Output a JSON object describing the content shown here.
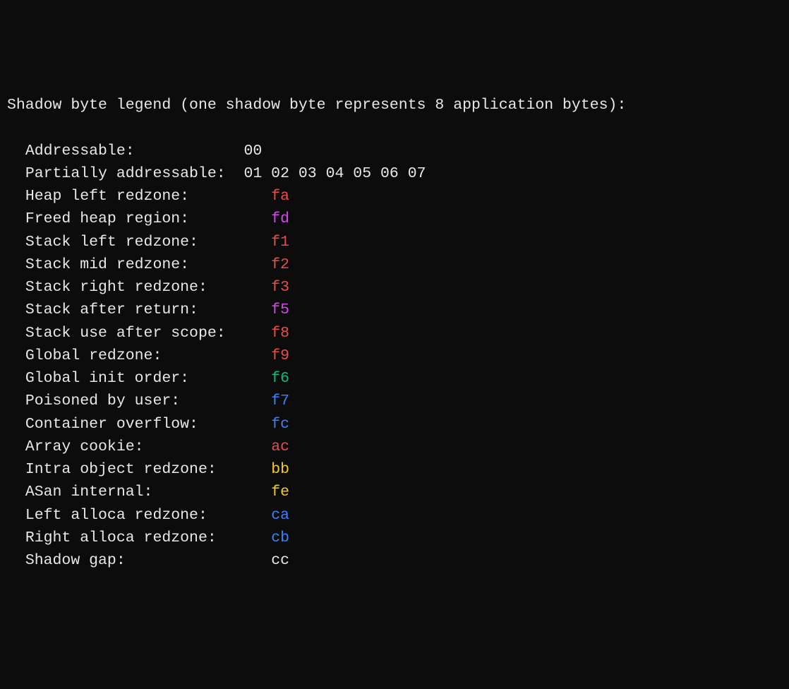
{
  "title": "Shadow byte legend (one shadow byte represents 8 application bytes):",
  "indent": "  ",
  "labelWidth": 24,
  "entries": [
    {
      "label": "Addressable:",
      "value": "00",
      "color": "white"
    },
    {
      "label": "Partially addressable:",
      "value": "01 02 03 04 05 06 07",
      "color": "white"
    },
    {
      "label": "Heap left redzone:",
      "value": "fa",
      "color": "red",
      "pad": 3
    },
    {
      "label": "Freed heap region:",
      "value": "fd",
      "color": "magenta",
      "pad": 3
    },
    {
      "label": "Stack left redzone:",
      "value": "f1",
      "color": "red",
      "pad": 3
    },
    {
      "label": "Stack mid redzone:",
      "value": "f2",
      "color": "red",
      "pad": 3
    },
    {
      "label": "Stack right redzone:",
      "value": "f3",
      "color": "red",
      "pad": 3
    },
    {
      "label": "Stack after return:",
      "value": "f5",
      "color": "magenta",
      "pad": 3
    },
    {
      "label": "Stack use after scope:",
      "value": "f8",
      "color": "red",
      "pad": 3
    },
    {
      "label": "Global redzone:",
      "value": "f9",
      "color": "red",
      "pad": 3
    },
    {
      "label": "Global init order:",
      "value": "f6",
      "color": "green",
      "pad": 3
    },
    {
      "label": "Poisoned by user:",
      "value": "f7",
      "color": "blue",
      "pad": 3
    },
    {
      "label": "Container overflow:",
      "value": "fc",
      "color": "blue",
      "pad": 3
    },
    {
      "label": "Array cookie:",
      "value": "ac",
      "color": "red",
      "pad": 3
    },
    {
      "label": "Intra object redzone:",
      "value": "bb",
      "color": "yellow",
      "pad": 3
    },
    {
      "label": "ASan internal:",
      "value": "fe",
      "color": "yellow",
      "pad": 3
    },
    {
      "label": "Left alloca redzone:",
      "value": "ca",
      "color": "blue",
      "pad": 3
    },
    {
      "label": "Right alloca redzone:",
      "value": "cb",
      "color": "blue",
      "pad": 3
    },
    {
      "label": "Shadow gap:",
      "value": "cc",
      "color": "white",
      "pad": 3
    }
  ]
}
